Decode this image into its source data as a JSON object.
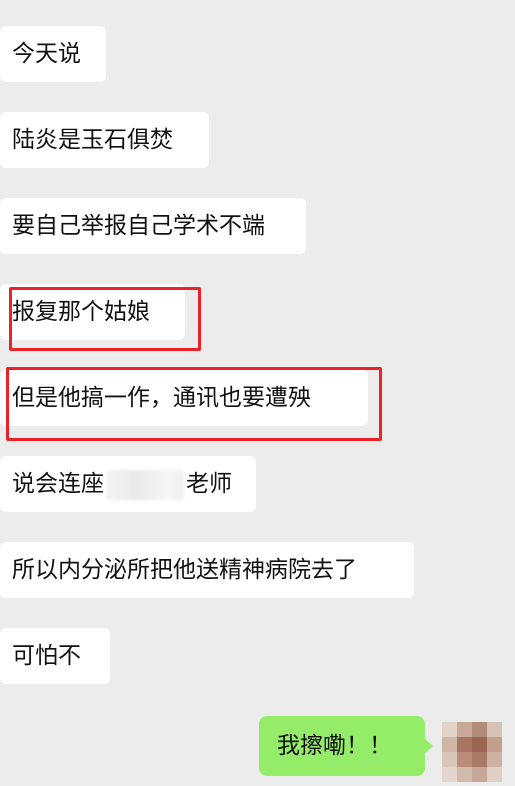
{
  "conversation": {
    "incoming": [
      "今天说",
      "陆炎是玉石俱焚",
      "要自己举报自己学术不端",
      "报复那个姑娘",
      "但是他搞一作，通讯也要遭殃",
      "说会连座",
      "老师",
      "所以内分泌所把他送精神病院去了",
      "可怕不"
    ],
    "outgoing": "我擦嘞！！"
  },
  "colors": {
    "background": "#ececec",
    "incoming_bubble": "#ffffff",
    "outgoing_bubble": "#95ec69",
    "highlight_border": "#e8242a"
  }
}
